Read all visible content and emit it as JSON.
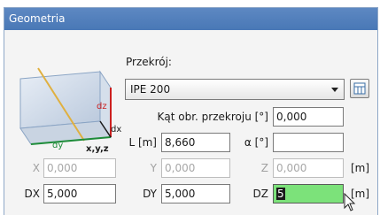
{
  "panel": {
    "title": "Geometria"
  },
  "diagram": {
    "labels": {
      "dz": "dz",
      "dx": "dx",
      "dy": "dy",
      "origin": "x,y,z"
    },
    "colors": {
      "dz": "#cc1f1f",
      "dx": "#1a1a1a",
      "dy": "#1e8c3a",
      "diagonal": "#e0b040",
      "frame": "#5f8fc0"
    }
  },
  "section": {
    "label": "Przekrój:",
    "selected": "IPE 200"
  },
  "angle": {
    "label": "Kąt obr. przekroju [°]",
    "value": "0,000"
  },
  "length": {
    "label": "L [m]",
    "value": "8,660"
  },
  "alpha": {
    "label": "α [°]",
    "value": ""
  },
  "coords": {
    "x": {
      "label": "X",
      "value": "0,000"
    },
    "y": {
      "label": "Y",
      "value": "0,000"
    },
    "z": {
      "label": "Z",
      "value": "0,000"
    },
    "unit": "[m]"
  },
  "deltas": {
    "dx": {
      "label": "DX",
      "value": "5,000"
    },
    "dy": {
      "label": "DY",
      "value": "5,000"
    },
    "dz": {
      "label": "DZ",
      "value": "5"
    },
    "unit": "[m]"
  },
  "theme": {
    "title_bg": "#4f7fbd",
    "active_field": "#7ce27a"
  }
}
